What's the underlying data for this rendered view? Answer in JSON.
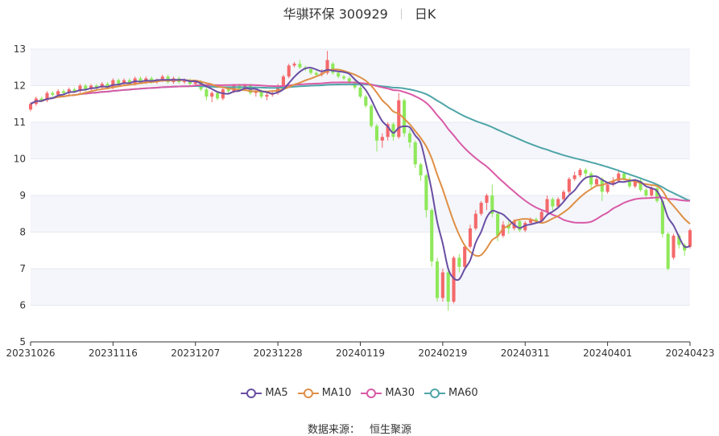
{
  "header": {
    "stock": "华骐环保 300929",
    "period": "日K"
  },
  "source": {
    "label": "数据来源：",
    "provider": "恒生聚源"
  },
  "colors": {
    "up": "#f4696b",
    "down": "#8fe85a",
    "ma5": "#6a4ea3",
    "ma10": "#df8f46",
    "ma30": "#d95aa7",
    "ma60": "#4fa5a8",
    "grid": "#e6e9f0",
    "band": "#f4f6fb",
    "axis": "#333333"
  },
  "chart_data": {
    "type": "candlestick",
    "ylim": [
      5,
      13
    ],
    "yticks": [
      5,
      6,
      7,
      8,
      9,
      10,
      11,
      12,
      13
    ],
    "xticks": [
      "20231026",
      "20231116",
      "20231207",
      "20231228",
      "20240119",
      "20240219",
      "20240311",
      "20240401",
      "20240423"
    ],
    "xtick_index": [
      0,
      15,
      30,
      45,
      60,
      75,
      90,
      105,
      120
    ],
    "legend": [
      {
        "key": "ma5",
        "label": "MA5",
        "color": "#6a4ea3"
      },
      {
        "key": "ma10",
        "label": "MA10",
        "color": "#df8f46"
      },
      {
        "key": "ma30",
        "label": "MA30",
        "color": "#d95aa7"
      },
      {
        "key": "ma60",
        "label": "MA60",
        "color": "#4fa5a8"
      }
    ],
    "candles": [
      [
        11.35,
        11.5,
        11.3,
        11.55
      ],
      [
        11.5,
        11.65,
        11.45,
        11.7
      ],
      [
        11.65,
        11.6,
        11.55,
        11.7
      ],
      [
        11.6,
        11.8,
        11.55,
        11.85
      ],
      [
        11.8,
        11.75,
        11.7,
        11.85
      ],
      [
        11.75,
        11.85,
        11.7,
        11.9
      ],
      [
        11.85,
        11.8,
        11.75,
        11.9
      ],
      [
        11.8,
        11.9,
        11.75,
        11.95
      ],
      [
        11.9,
        11.85,
        11.8,
        11.95
      ],
      [
        11.85,
        12.0,
        11.8,
        12.05
      ],
      [
        12.0,
        11.9,
        11.85,
        12.05
      ],
      [
        11.9,
        12.0,
        11.85,
        12.05
      ],
      [
        12.0,
        11.95,
        11.9,
        12.05
      ],
      [
        11.95,
        12.05,
        11.9,
        12.1
      ],
      [
        12.05,
        11.95,
        11.9,
        12.1
      ],
      [
        11.95,
        12.15,
        11.9,
        12.2
      ],
      [
        12.15,
        12.05,
        12.0,
        12.2
      ],
      [
        12.05,
        12.15,
        12.0,
        12.2
      ],
      [
        12.15,
        12.05,
        12.0,
        12.2
      ],
      [
        12.05,
        12.2,
        12.0,
        12.25
      ],
      [
        12.2,
        12.1,
        12.05,
        12.25
      ],
      [
        12.1,
        12.2,
        12.05,
        12.25
      ],
      [
        12.2,
        12.1,
        12.05,
        12.25
      ],
      [
        12.1,
        12.15,
        12.05,
        12.2
      ],
      [
        12.15,
        12.25,
        12.1,
        12.3
      ],
      [
        12.25,
        12.1,
        12.05,
        12.3
      ],
      [
        12.1,
        12.2,
        12.05,
        12.25
      ],
      [
        12.2,
        12.1,
        12.05,
        12.25
      ],
      [
        12.1,
        12.15,
        12.05,
        12.2
      ],
      [
        12.15,
        12.05,
        12.0,
        12.2
      ],
      [
        12.05,
        12.1,
        12.0,
        12.15
      ],
      [
        12.1,
        11.9,
        11.85,
        12.15
      ],
      [
        11.9,
        11.7,
        11.6,
        11.95
      ],
      [
        11.7,
        11.8,
        11.55,
        11.85
      ],
      [
        11.8,
        11.65,
        11.6,
        11.85
      ],
      [
        11.65,
        11.9,
        11.6,
        11.95
      ],
      [
        11.9,
        11.85,
        11.8,
        11.95
      ],
      [
        11.85,
        12.0,
        11.8,
        12.05
      ],
      [
        12.0,
        11.9,
        11.85,
        12.05
      ],
      [
        11.9,
        12.0,
        11.85,
        12.05
      ],
      [
        12.0,
        11.8,
        11.75,
        12.05
      ],
      [
        11.8,
        11.85,
        11.7,
        11.9
      ],
      [
        11.85,
        11.7,
        11.65,
        11.9
      ],
      [
        11.7,
        11.75,
        11.6,
        11.8
      ],
      [
        11.75,
        11.8,
        11.7,
        11.85
      ],
      [
        11.8,
        12.0,
        11.75,
        12.05
      ],
      [
        12.0,
        12.25,
        11.95,
        12.3
      ],
      [
        12.25,
        12.55,
        12.2,
        12.6
      ],
      [
        12.55,
        12.6,
        12.5,
        12.65
      ],
      [
        12.6,
        12.5,
        12.45,
        12.7
      ],
      [
        12.5,
        12.45,
        12.4,
        12.55
      ],
      [
        12.45,
        12.35,
        12.3,
        12.5
      ],
      [
        12.35,
        12.3,
        12.25,
        12.4
      ],
      [
        12.3,
        12.35,
        12.25,
        12.45
      ],
      [
        12.35,
        12.7,
        12.3,
        12.95
      ],
      [
        12.6,
        12.35,
        12.3,
        12.65
      ],
      [
        12.35,
        12.25,
        12.2,
        12.4
      ],
      [
        12.25,
        12.2,
        12.15,
        12.3
      ],
      [
        12.2,
        12.1,
        12.05,
        12.25
      ],
      [
        12.1,
        11.95,
        11.9,
        12.15
      ],
      [
        11.95,
        11.7,
        11.65,
        12.0
      ],
      [
        11.7,
        11.45,
        11.4,
        11.75
      ],
      [
        11.45,
        10.9,
        10.85,
        11.5
      ],
      [
        10.9,
        10.5,
        10.2,
        10.95
      ],
      [
        10.5,
        10.6,
        10.3,
        10.7
      ],
      [
        10.6,
        10.95,
        10.5,
        11.0
      ],
      [
        10.95,
        10.6,
        10.5,
        11.0
      ],
      [
        10.6,
        11.6,
        10.55,
        11.8
      ],
      [
        11.6,
        10.7,
        10.6,
        11.65
      ],
      [
        10.7,
        10.45,
        10.3,
        10.8
      ],
      [
        10.45,
        9.85,
        9.75,
        10.5
      ],
      [
        9.85,
        9.55,
        9.4,
        9.9
      ],
      [
        9.55,
        8.6,
        8.4,
        9.6
      ],
      [
        8.6,
        7.2,
        7.05,
        8.65
      ],
      [
        7.2,
        6.2,
        6.1,
        7.3
      ],
      [
        6.2,
        6.9,
        6.1,
        7.0
      ],
      [
        6.9,
        6.1,
        5.85,
        6.95
      ],
      [
        6.1,
        7.3,
        6.05,
        7.35
      ],
      [
        7.3,
        7.05,
        6.9,
        7.4
      ],
      [
        7.05,
        7.6,
        7.0,
        7.65
      ],
      [
        7.6,
        8.1,
        7.55,
        8.2
      ],
      [
        8.1,
        8.5,
        8.05,
        8.6
      ],
      [
        8.5,
        8.8,
        8.45,
        8.85
      ],
      [
        8.8,
        9.0,
        8.6,
        9.05
      ],
      [
        9.0,
        8.5,
        8.4,
        9.3
      ],
      [
        8.5,
        7.9,
        7.75,
        8.55
      ],
      [
        7.9,
        8.2,
        7.85,
        8.3
      ],
      [
        8.2,
        8.1,
        7.95,
        8.3
      ],
      [
        8.1,
        8.3,
        8.05,
        8.35
      ],
      [
        8.3,
        8.05,
        8.0,
        8.35
      ],
      [
        8.05,
        8.25,
        8.0,
        8.3
      ],
      [
        8.25,
        8.35,
        8.2,
        8.4
      ],
      [
        8.35,
        8.3,
        8.25,
        8.4
      ],
      [
        8.3,
        8.55,
        8.25,
        8.6
      ],
      [
        8.55,
        8.9,
        8.5,
        9.0
      ],
      [
        8.9,
        8.7,
        8.6,
        8.95
      ],
      [
        8.7,
        8.9,
        8.65,
        8.95
      ],
      [
        8.9,
        9.1,
        8.85,
        9.15
      ],
      [
        9.1,
        9.45,
        9.05,
        9.5
      ],
      [
        9.45,
        9.55,
        9.4,
        9.65
      ],
      [
        9.55,
        9.7,
        9.5,
        9.75
      ],
      [
        9.7,
        9.6,
        9.5,
        9.75
      ],
      [
        9.6,
        9.3,
        9.2,
        9.65
      ],
      [
        9.3,
        9.45,
        9.25,
        9.5
      ],
      [
        9.45,
        9.1,
        8.85,
        9.5
      ],
      [
        9.1,
        9.3,
        9.05,
        9.35
      ],
      [
        9.3,
        9.4,
        9.25,
        9.5
      ],
      [
        9.4,
        9.6,
        9.35,
        9.7
      ],
      [
        9.6,
        9.45,
        9.4,
        9.65
      ],
      [
        9.45,
        9.25,
        9.2,
        9.5
      ],
      [
        9.25,
        9.4,
        9.2,
        9.45
      ],
      [
        9.4,
        9.15,
        9.1,
        9.45
      ],
      [
        9.15,
        9.0,
        8.95,
        9.2
      ],
      [
        9.0,
        9.2,
        8.95,
        9.25
      ],
      [
        9.2,
        8.85,
        8.8,
        9.25
      ],
      [
        8.85,
        7.95,
        7.85,
        8.9
      ],
      [
        7.95,
        7.0,
        6.95,
        8.0
      ],
      [
        7.3,
        7.9,
        7.25,
        7.95
      ],
      [
        7.9,
        7.65,
        7.55,
        7.95
      ],
      [
        7.65,
        7.5,
        7.35,
        7.7
      ],
      [
        7.6,
        8.05,
        7.55,
        8.1
      ]
    ]
  }
}
